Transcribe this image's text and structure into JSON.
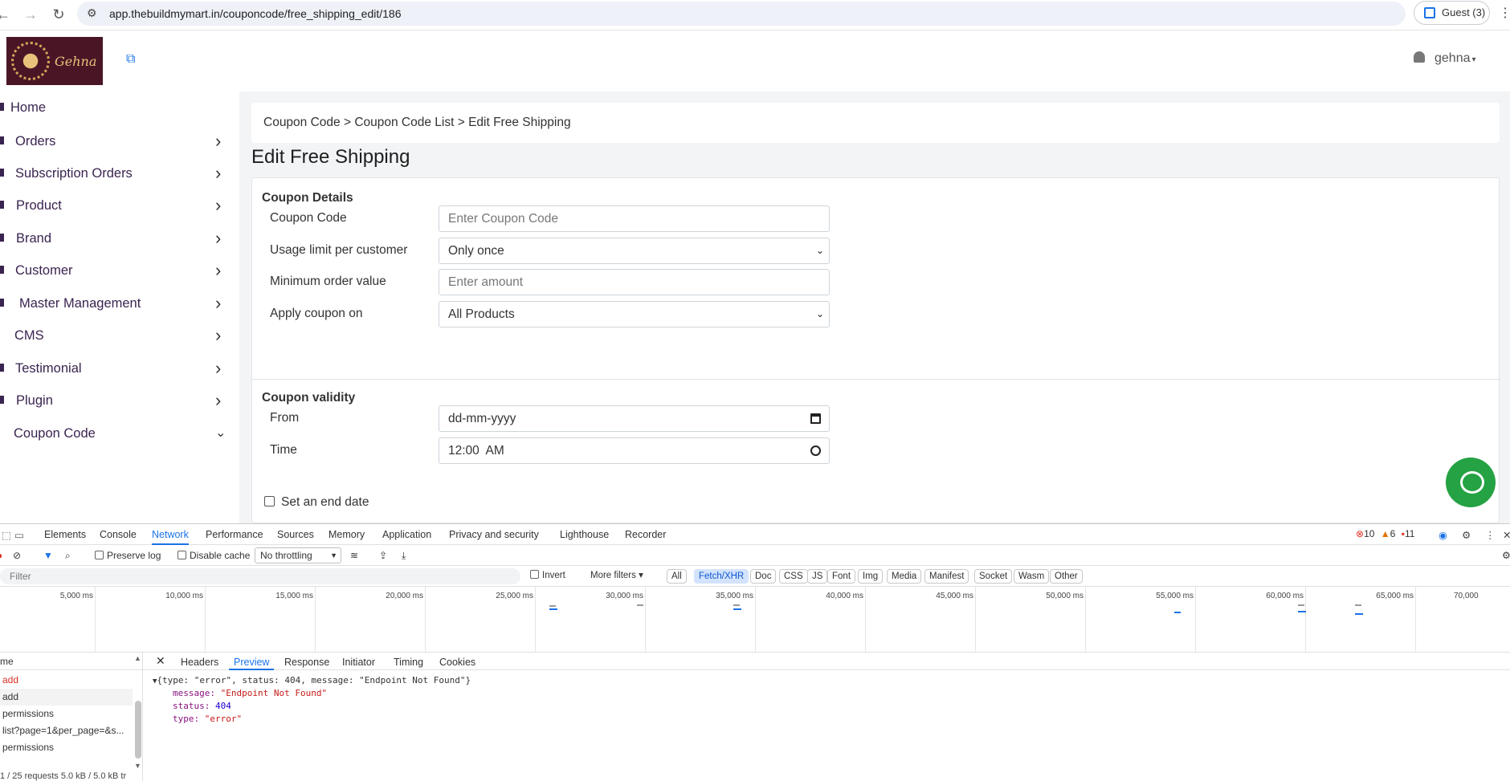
{
  "browser": {
    "url": "app.thebuildmymart.in/couponcode/free_shipping_edit/186",
    "profile_label": "Guest (3)"
  },
  "header": {
    "brand": "Gehna",
    "user_name": "gehna"
  },
  "sidebar": {
    "items": [
      {
        "label": "Home",
        "chevron": ""
      },
      {
        "label": "Orders",
        "chevron": "›"
      },
      {
        "label": "Subscription Orders",
        "chevron": "›"
      },
      {
        "label": "Product",
        "chevron": "›"
      },
      {
        "label": "Brand",
        "chevron": "›"
      },
      {
        "label": "Customer",
        "chevron": "›"
      },
      {
        "label": "Master Management",
        "chevron": "›"
      },
      {
        "label": "CMS",
        "chevron": "›"
      },
      {
        "label": "Testimonial",
        "chevron": "›"
      },
      {
        "label": "Plugin",
        "chevron": "›"
      },
      {
        "label": "Coupon Code",
        "chevron": "⌄"
      }
    ]
  },
  "main": {
    "breadcrumb": "Coupon Code > Coupon Code List > Edit Free Shipping",
    "title": "Edit Free Shipping",
    "coupon_details": {
      "heading": "Coupon Details",
      "code_label": "Coupon Code",
      "code_placeholder": "Enter Coupon Code",
      "usage_label": "Usage limit per customer",
      "usage_value": "Only once",
      "min_order_label": "Minimum order value",
      "min_order_placeholder": "Enter amount",
      "apply_label": "Apply coupon on",
      "apply_value": "All Products"
    },
    "validity": {
      "heading": "Coupon validity",
      "from_label": "From",
      "from_placeholder": "dd-mm-yyyy",
      "time_label": "Time",
      "time_value": "12:00  AM",
      "end_date_label": "Set an end date"
    }
  },
  "devtools": {
    "tabs": [
      "Elements",
      "Console",
      "Network",
      "Performance",
      "Sources",
      "Memory",
      "Application",
      "Privacy and security",
      "Lighthouse",
      "Recorder"
    ],
    "active_tab": "Network",
    "errors": "10",
    "warnings": "6",
    "issues": "11",
    "preserve_log": "Preserve log",
    "disable_cache": "Disable cache",
    "throttling": "No throttling",
    "filter_placeholder": "Filter",
    "invert": "Invert",
    "more_filters": "More filters",
    "type_filters": [
      "All",
      "Fetch/XHR",
      "Doc",
      "CSS",
      "JS",
      "Font",
      "Img",
      "Media",
      "Manifest",
      "Socket",
      "Wasm",
      "Other"
    ],
    "active_filter": "Fetch/XHR",
    "timeline_ticks": [
      "5,000 ms",
      "10,000 ms",
      "15,000 ms",
      "20,000 ms",
      "25,000 ms",
      "30,000 ms",
      "35,000 ms",
      "40,000 ms",
      "45,000 ms",
      "50,000 ms",
      "55,000 ms",
      "60,000 ms",
      "65,000 ms",
      "70,000"
    ],
    "name_column": "me",
    "requests": [
      {
        "name": "add",
        "error": true
      },
      {
        "name": "add",
        "error": false
      },
      {
        "name": "permissions",
        "error": false
      },
      {
        "name": "list?page=1&per_page=&s...",
        "error": false
      },
      {
        "name": "permissions",
        "error": false
      }
    ],
    "status_bar": "1 / 25 requests   5.0 kB / 5.0 kB tr",
    "detail_tabs": [
      "Headers",
      "Preview",
      "Response",
      "Initiator",
      "Timing",
      "Cookies"
    ],
    "active_detail_tab": "Preview",
    "preview": {
      "summary": "{type: \"error\", status: 404, message: \"Endpoint Not Found\"}",
      "message_key": "message:",
      "message_val": "\"Endpoint Not Found\"",
      "status_key": "status:",
      "status_val": "404",
      "type_key": "type:",
      "type_val": "\"error\""
    }
  }
}
